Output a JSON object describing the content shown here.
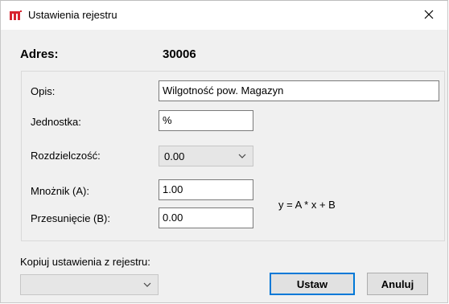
{
  "window": {
    "title": "Ustawienia rejestru",
    "app_icon": "program-logo-icon",
    "close_icon": "close-icon",
    "accent_color": "#d72631"
  },
  "address": {
    "label": "Adres:",
    "value": "30006"
  },
  "form": {
    "description_label": "Opis:",
    "description_value": "Wilgotność pow. Magazyn",
    "unit_label": "Jednostka:",
    "unit_value": "%",
    "resolution_label": "Rozdzielczość:",
    "resolution_value": "0.00",
    "multiplier_label": "Mnożnik (A):",
    "multiplier_value": "1.00",
    "offset_label": "Przesunięcie (B):",
    "offset_value": "0.00",
    "formula": "y = A * x + B"
  },
  "copy": {
    "label": "Kopiuj ustawienia z rejestru:",
    "selected": ""
  },
  "buttons": {
    "set_label": "Ustaw",
    "cancel_label": "Anuluj"
  }
}
